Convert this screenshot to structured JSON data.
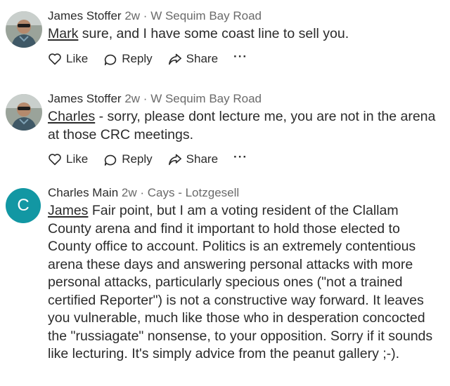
{
  "comments": [
    {
      "author": "James Stoffer",
      "time": "2w",
      "separator": "·",
      "location": "W Sequim Bay Road",
      "mention": "Mark",
      "text": " sure, and I have some coast line to sell you.",
      "actions": {
        "like": "Like",
        "reply": "Reply",
        "share": "Share",
        "more": "···"
      }
    },
    {
      "author": "James Stoffer",
      "time": "2w",
      "separator": "·",
      "location": "W Sequim Bay Road",
      "mention": "Charles",
      "text": " - sorry, please dont lecture me, you are not in the arena at those CRC meetings.",
      "actions": {
        "like": "Like",
        "reply": "Reply",
        "share": "Share",
        "more": "···"
      }
    },
    {
      "author": "Charles Main",
      "avatar_letter": "C",
      "avatar_color": "#1297a3",
      "time": "2w",
      "separator": "·",
      "location": "Cays - Lotzgesell",
      "mention": "James",
      "text": " Fair point, but I am a voting resident of the Clallam County arena and find it important to hold those elected to County office to account.  Politics is an extremely contentious arena these days and answering personal attacks with more personal attacks, particularly specious ones (\"not a trained certified Reporter\") is not a constructive way forward.  It leaves you vulnerable, much like those who in desperation concocted the \"russiagate\" nonsense, to your opposition.  Sorry if it sounds like lecturing.  It's simply advice from the peanut gallery ;-)."
    }
  ]
}
